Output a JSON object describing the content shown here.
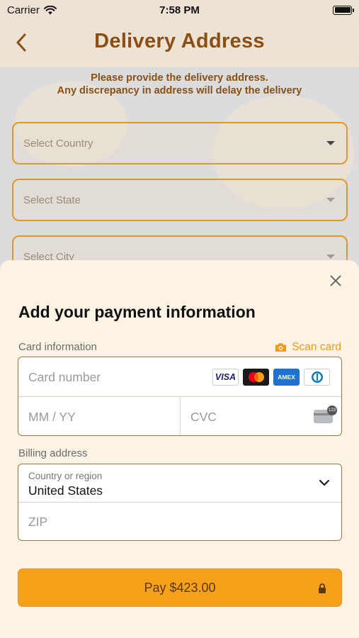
{
  "status_bar": {
    "carrier": "Carrier",
    "time": "7:58 PM"
  },
  "header": {
    "title": "Delivery Address",
    "back_icon": "chevron-left-icon"
  },
  "delivery_form": {
    "instruction_line1": "Please provide the delivery address.",
    "instruction_line2": "Any discrepancy in address will delay the delivery",
    "country_placeholder": "Select Country",
    "state_placeholder": "Select State",
    "city_placeholder": "Select City"
  },
  "payment_sheet": {
    "title": "Add your payment information",
    "card_info_label": "Card information",
    "scan_card_label": "Scan card",
    "card_number_placeholder": "Card number",
    "expiry_placeholder": "MM / YY",
    "cvc_placeholder": "CVC",
    "card_brands": [
      "VISA",
      "Mastercard",
      "AMEX",
      "Diners Club"
    ],
    "billing_label": "Billing address",
    "country_field_label": "Country or region",
    "country_value": "United States",
    "zip_placeholder": "ZIP",
    "pay_label": "Pay $423.00"
  },
  "colors": {
    "brand_brown": "#8a4f14",
    "accent_orange": "#f7a11a",
    "field_border": "#e8961c",
    "sheet_background": "#fdf3e4"
  }
}
